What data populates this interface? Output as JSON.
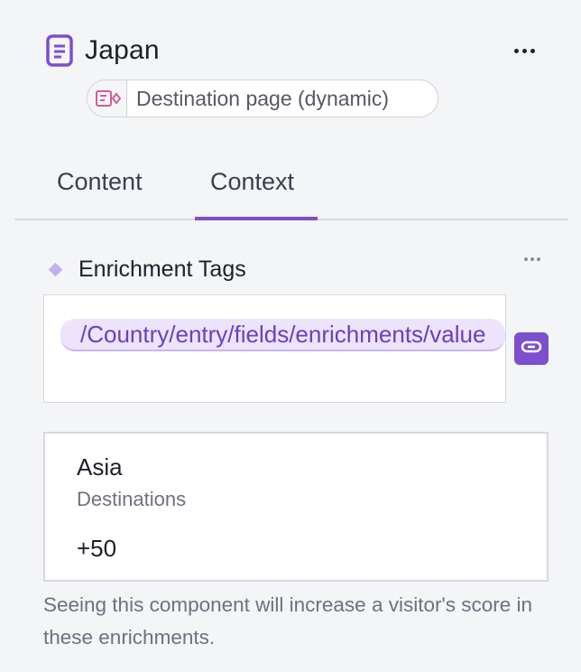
{
  "header": {
    "title": "Japan",
    "title_icon": "document-icon",
    "more_icon": "more-horizontal-icon",
    "type_pill": {
      "icon": "dynamic-page-icon",
      "label": "Destination page (dynamic)"
    }
  },
  "tabs": [
    {
      "label": "Content",
      "active": false
    },
    {
      "label": "Context",
      "active": true
    }
  ],
  "enrichment_section": {
    "title": "Enrichment Tags",
    "marker_icon": "diamond-icon",
    "more_icon": "more-horizontal-icon",
    "binding_value": "/Country/entry/fields/enrichments/value",
    "link_icon": "link-icon",
    "card": {
      "name": "Asia",
      "category": "Destinations",
      "score": "+50"
    },
    "help_text": "Seeing this component will increase a visitor's score in these enrichments."
  },
  "colors": {
    "accent": "#7c4fcf",
    "chip_bg": "#ede3fb",
    "muted_text": "#6d7080"
  }
}
